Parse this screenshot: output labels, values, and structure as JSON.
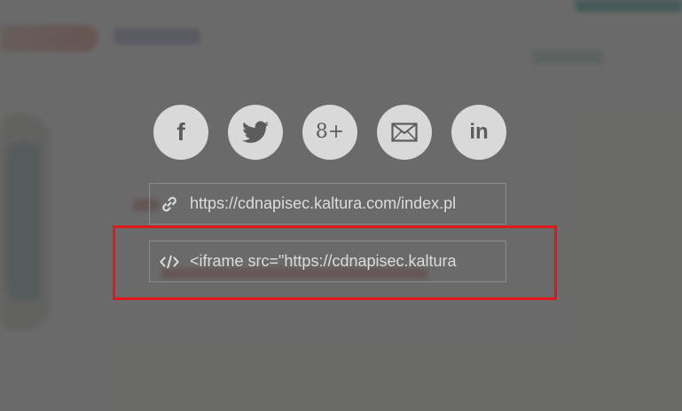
{
  "share": {
    "buttons": [
      {
        "name": "facebook",
        "icon": "facebook-icon",
        "glyph": "f"
      },
      {
        "name": "twitter",
        "icon": "twitter-icon"
      },
      {
        "name": "google-plus",
        "icon": "google-plus-icon",
        "glyph": "8+"
      },
      {
        "name": "email",
        "icon": "email-icon"
      },
      {
        "name": "linkedin",
        "icon": "linkedin-icon",
        "glyph": "in"
      }
    ],
    "link_url": "https://cdnapisec.kaltura.com/index.pl",
    "embed_code": "<iframe src=\"https://cdnapisec.kaltura",
    "link_icon": "link-icon",
    "embed_icon": "code-icon"
  },
  "colors": {
    "overlay": "#484848",
    "button_bg": "#d9d9d9",
    "icon": "#5c5c5c",
    "field_text": "#dcdcdc",
    "highlight": "#e3161b"
  }
}
